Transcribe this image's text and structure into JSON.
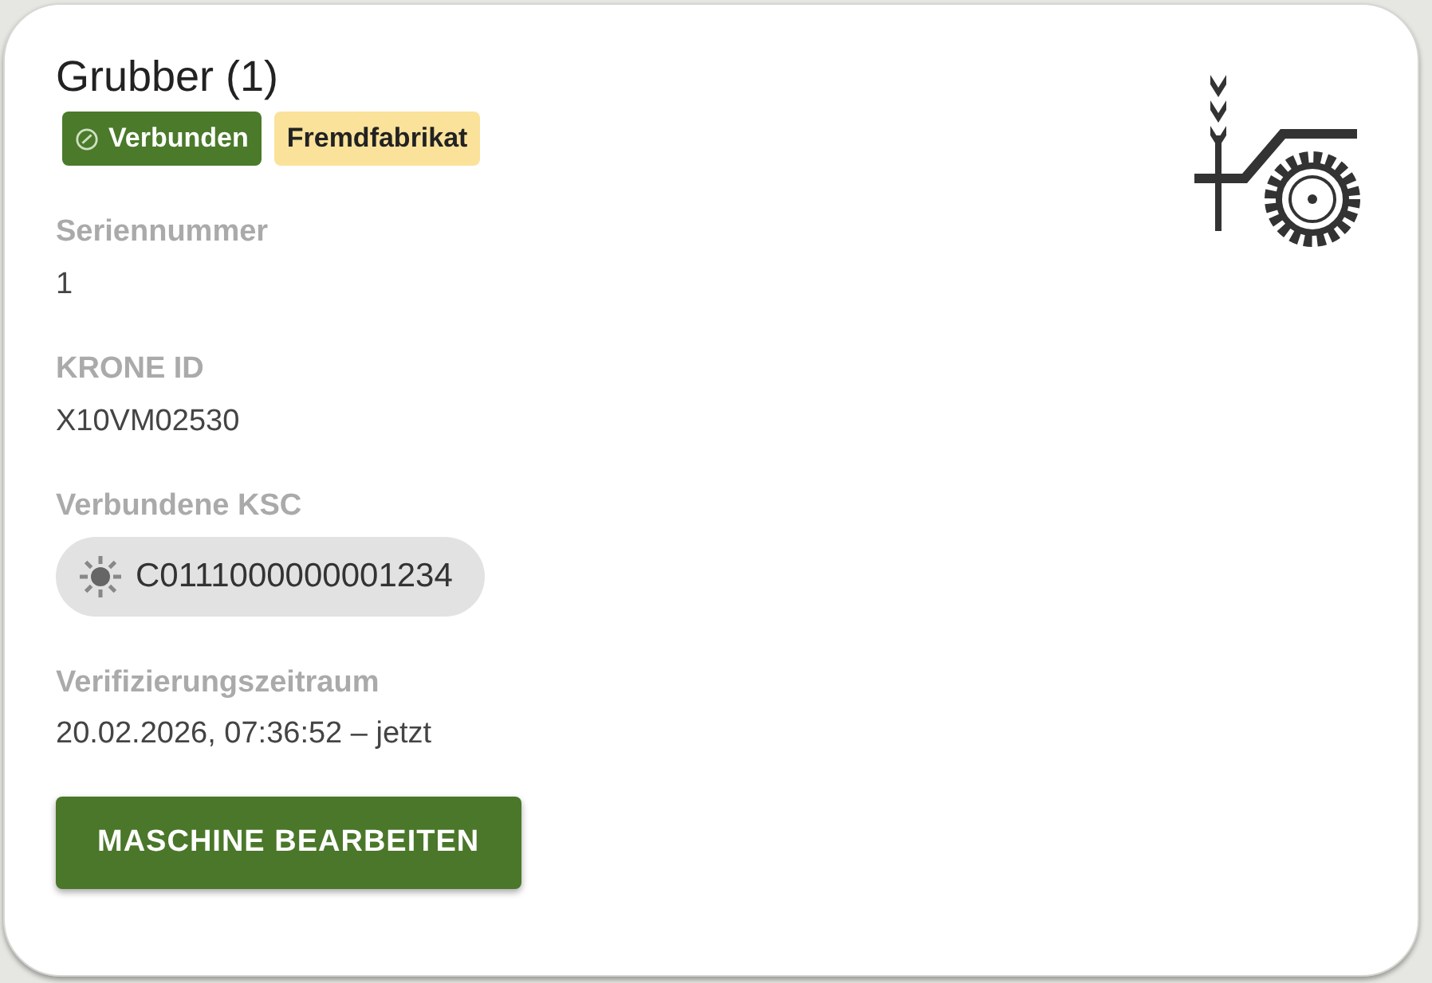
{
  "card": {
    "title": "Grubber (1)",
    "badges": [
      {
        "label": "Verbunden",
        "kind": "success"
      },
      {
        "label": "Fremdfabrikat",
        "kind": "warning"
      }
    ],
    "fields": [
      {
        "label": "Seriennummer",
        "value": "1",
        "kind": "text"
      },
      {
        "label": "KRONE ID",
        "value": "X10VM02530",
        "kind": "text"
      },
      {
        "label": "Verbundene KSC",
        "value": "C0111000000001234",
        "kind": "chip"
      },
      {
        "label": "Verifizierungszeitraum",
        "value": "20.02.2026, 07:36:52 – jetzt",
        "kind": "text"
      }
    ],
    "button": "MASCHINE BEARBEITEN"
  }
}
